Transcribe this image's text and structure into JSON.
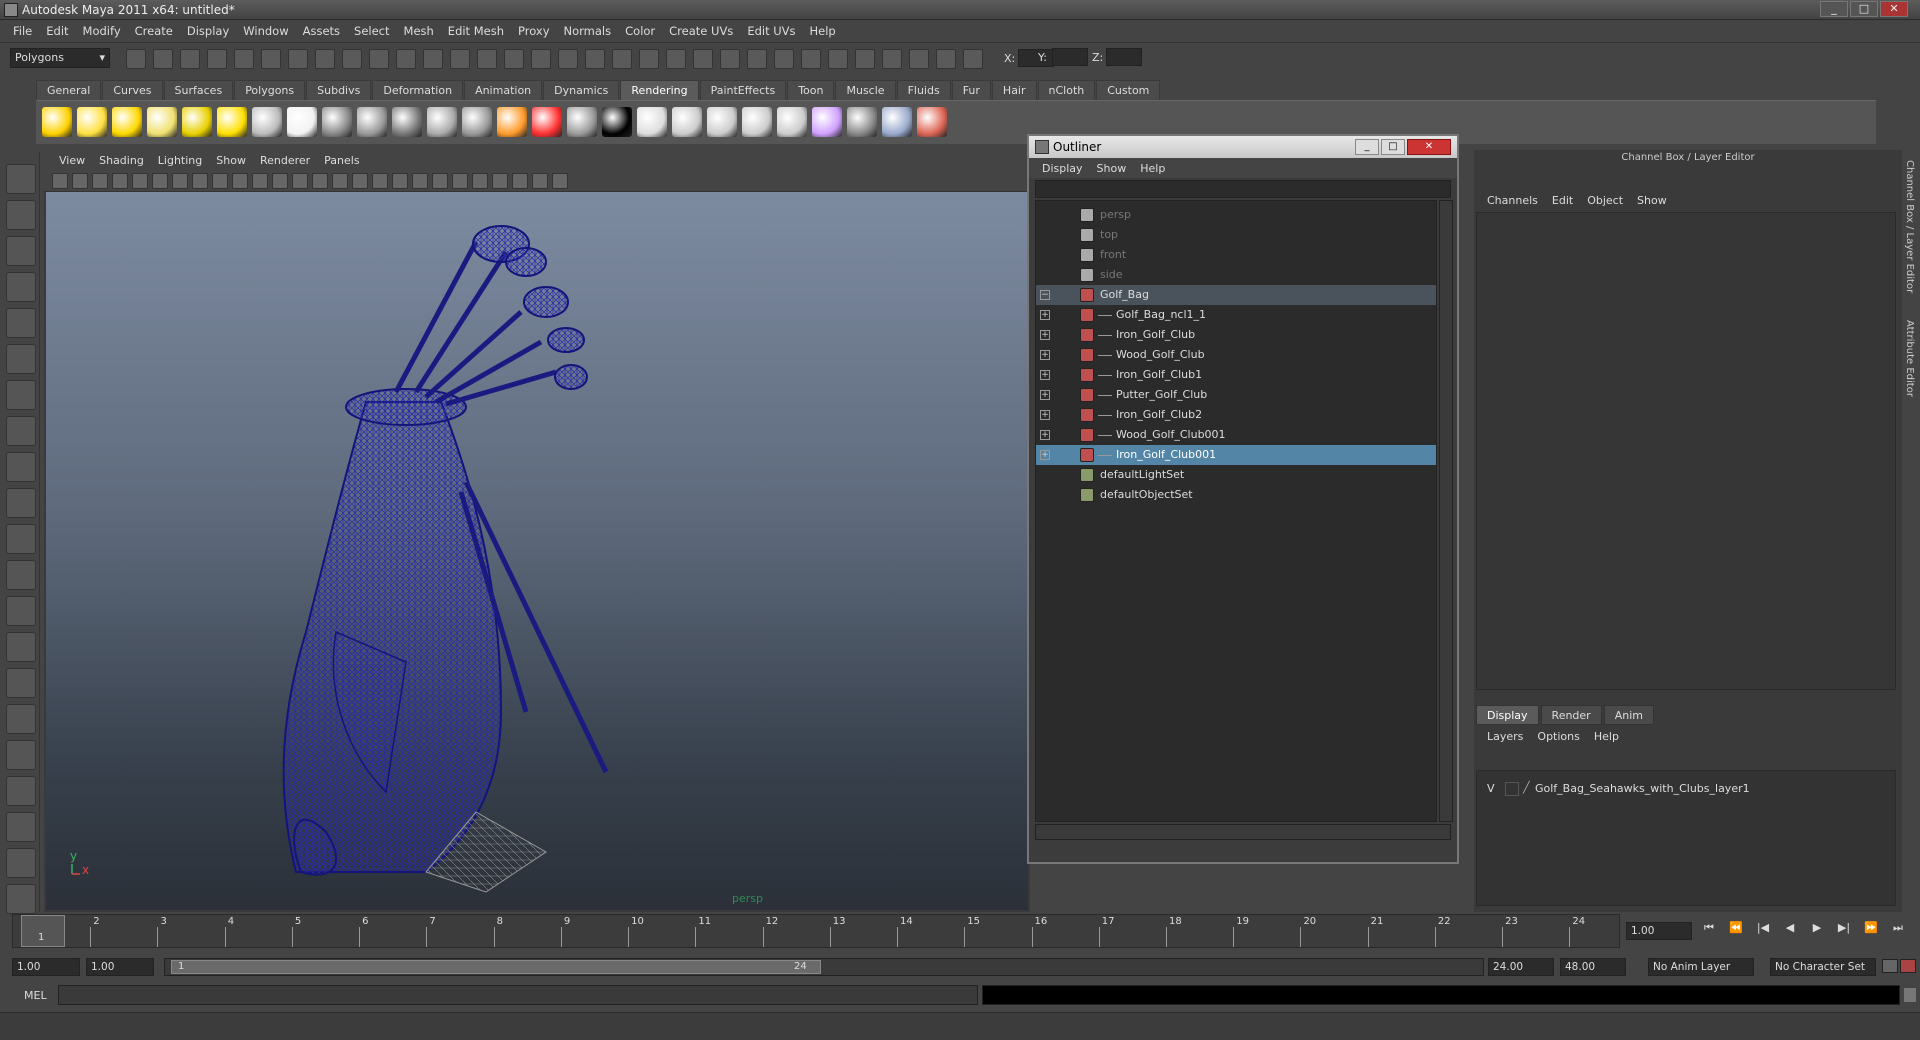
{
  "window": {
    "title": "Autodesk Maya 2011 x64: untitled*",
    "min": "_",
    "max": "□",
    "close": "✕"
  },
  "menu": [
    "File",
    "Edit",
    "Modify",
    "Create",
    "Display",
    "Window",
    "Assets",
    "Select",
    "Mesh",
    "Edit Mesh",
    "Proxy",
    "Normals",
    "Color",
    "Create UVs",
    "Edit UVs",
    "Help"
  ],
  "status": {
    "mode": "Polygons",
    "x_label": "X:",
    "y_label": "Y:",
    "z_label": "Z:"
  },
  "shelf_tabs": [
    "General",
    "Curves",
    "Surfaces",
    "Polygons",
    "Subdivs",
    "Deformation",
    "Animation",
    "Dynamics",
    "Rendering",
    "PaintEffects",
    "Toon",
    "Muscle",
    "Fluids",
    "Fur",
    "Hair",
    "nCloth",
    "Custom"
  ],
  "shelf_active": "Rendering",
  "viewport": {
    "menu": [
      "View",
      "Shading",
      "Lighting",
      "Show",
      "Renderer",
      "Panels"
    ],
    "camera_label": "persp",
    "axis_y": "y",
    "axis_x": "x",
    "wire_color": "#1a1a7a"
  },
  "outliner": {
    "title": "Outliner",
    "menu": [
      "Display",
      "Show",
      "Help"
    ],
    "items": [
      {
        "label": "persp",
        "type": "camera",
        "state": "dim"
      },
      {
        "label": "top",
        "type": "camera",
        "state": "dim"
      },
      {
        "label": "front",
        "type": "camera",
        "state": "dim"
      },
      {
        "label": "side",
        "type": "camera",
        "state": "dim"
      },
      {
        "label": "Golf_Bag",
        "type": "mesh",
        "state": "highlight",
        "expand": "−"
      },
      {
        "label": "Golf_Bag_ncl1_1",
        "type": "mesh",
        "state": "child",
        "expand": "+"
      },
      {
        "label": "Iron_Golf_Club",
        "type": "mesh",
        "state": "child",
        "expand": "+"
      },
      {
        "label": "Wood_Golf_Club",
        "type": "mesh",
        "state": "child",
        "expand": "+"
      },
      {
        "label": "Iron_Golf_Club1",
        "type": "mesh",
        "state": "child",
        "expand": "+"
      },
      {
        "label": "Putter_Golf_Club",
        "type": "mesh",
        "state": "child",
        "expand": "+"
      },
      {
        "label": "Iron_Golf_Club2",
        "type": "mesh",
        "state": "child",
        "expand": "+"
      },
      {
        "label": "Wood_Golf_Club001",
        "type": "mesh",
        "state": "child",
        "expand": "+"
      },
      {
        "label": "Iron_Golf_Club001",
        "type": "mesh",
        "state": "selected",
        "expand": "+"
      },
      {
        "label": "defaultLightSet",
        "type": "set",
        "state": "normal"
      },
      {
        "label": "defaultObjectSet",
        "type": "set",
        "state": "normal"
      }
    ]
  },
  "channel_box": {
    "title": "Channel Box / Layer Editor",
    "menu": [
      "Channels",
      "Edit",
      "Object",
      "Show"
    ],
    "layer_tabs": [
      "Display",
      "Render",
      "Anim"
    ],
    "layer_active": "Display",
    "layer_menu": [
      "Layers",
      "Options",
      "Help"
    ],
    "layer": {
      "visible": "V",
      "name": "Golf_Bag_Seahawks_with_Clubs_layer1"
    }
  },
  "side_tabs": [
    "Channel Box / Layer Editor",
    "Attribute Editor"
  ],
  "timeline": {
    "ticks": [
      "1",
      "2",
      "3",
      "4",
      "5",
      "6",
      "7",
      "8",
      "9",
      "10",
      "11",
      "12",
      "13",
      "14",
      "15",
      "16",
      "17",
      "18",
      "19",
      "20",
      "21",
      "22",
      "23",
      "24"
    ],
    "current": "1",
    "current_frame_field": "1.00"
  },
  "playback": [
    "⏮",
    "⏪",
    "|◀",
    "◀",
    "▶",
    "▶|",
    "⏩",
    "⏭"
  ],
  "range": {
    "start": "1.00",
    "playstart": "1.00",
    "slider_start": "1",
    "slider_end": "24",
    "playend": "24.00",
    "end": "48.00",
    "anim_layer": "No Anim Layer",
    "char_set": "No Character Set"
  },
  "cmd": {
    "label": "MEL"
  }
}
